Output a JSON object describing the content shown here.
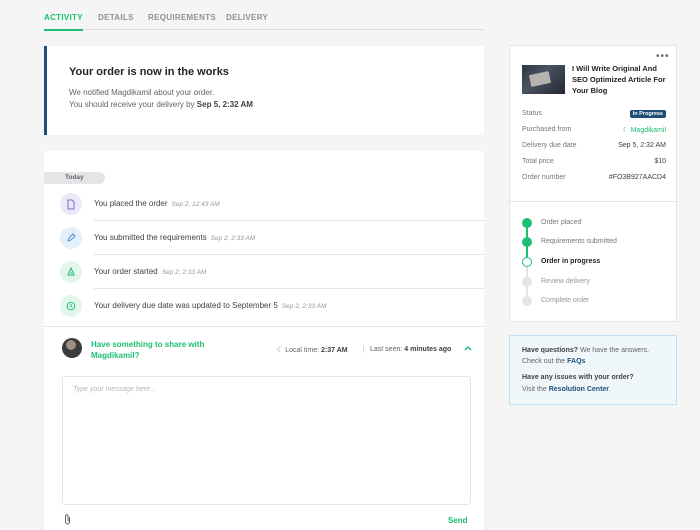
{
  "tabs": [
    "ACTIVITY",
    "DETAILS",
    "REQUIREMENTS",
    "DELIVERY"
  ],
  "status": {
    "title": "Your order is now in the works",
    "line1": "We notified Magdikamil about your order.",
    "line2_prefix": "You should receive your delivery by",
    "line2_date": "Sep 5, 2:32 AM"
  },
  "timeline": {
    "day_label": "Today",
    "events": [
      {
        "text": "You placed the order",
        "time": "Sep 2, 12:43 AM",
        "icon": "document-icon"
      },
      {
        "text": "You submitted the requirements",
        "time": "Sep 2, 2:33 AM",
        "icon": "pencil-icon"
      },
      {
        "text": "Your order started",
        "time": "Sep 2, 2:33 AM",
        "icon": "rocket-icon"
      },
      {
        "text": "Your delivery due date was updated to September 5",
        "time": "Sep 2, 2:33 AM",
        "icon": "clock-icon"
      }
    ]
  },
  "share": {
    "prompt": "Have something to share with Magdikamil?",
    "local_time_label": "Local time:",
    "local_time": "2:37 AM",
    "last_seen_label": "Last seen:",
    "last_seen": "4 minutes ago"
  },
  "message": {
    "placeholder": "Type your message here...",
    "send_label": "Send"
  },
  "order": {
    "gig_title": "I Will Write Original And SEO Optimized Article For Your Blog",
    "rows": {
      "status_label": "Status",
      "status_value": "In Progress",
      "purchased_label": "Purchased from",
      "purchased_value": "Magdikamil",
      "due_label": "Delivery due date",
      "due_value": "Sep 5, 2:32 AM",
      "price_label": "Total price",
      "price_value": "$10",
      "number_label": "Order number",
      "number_value": "#FO3B927AACD4"
    },
    "steps": [
      "Order placed",
      "Requirements submitted",
      "Order in progress",
      "Review delivery",
      "Complete order"
    ]
  },
  "help": {
    "q_title": "Have questions?",
    "q_rest": "We have the answers.",
    "faq_prefix": "Check out the",
    "faq_link": "FAQs",
    "issue_title": "Have any issues with your order?",
    "rc_prefix": "Visit the",
    "rc_link": "Resolution Center",
    "rc_suffix": "."
  },
  "colors": {
    "brand_green": "#1dbf73",
    "navy": "#1f4e79"
  }
}
